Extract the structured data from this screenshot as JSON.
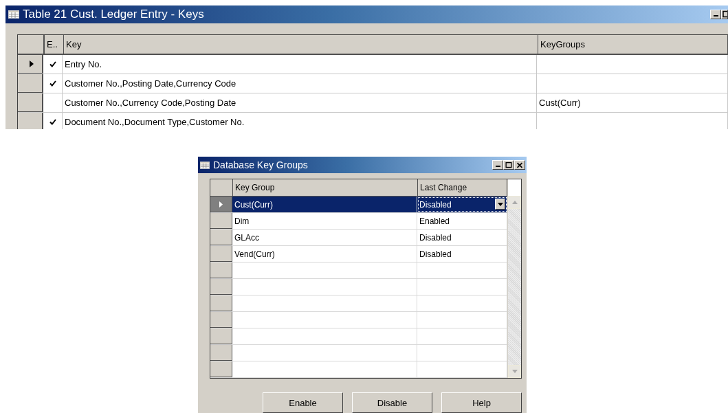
{
  "main_window": {
    "title": "Table 21 Cust. Ledger Entry - Keys",
    "table": {
      "columns": [
        "E..",
        "Key",
        "KeyGroups"
      ],
      "rows": [
        {
          "selected": true,
          "enabled": true,
          "key": "Entry No.",
          "key_groups": ""
        },
        {
          "selected": false,
          "enabled": true,
          "key": "Customer No.,Posting Date,Currency Code",
          "key_groups": ""
        },
        {
          "selected": false,
          "enabled": false,
          "key": "Customer No.,Currency Code,Posting Date",
          "key_groups": "Cust(Curr)"
        },
        {
          "selected": false,
          "enabled": true,
          "key": "Document No.,Document Type,Customer No.",
          "key_groups": ""
        }
      ]
    }
  },
  "dialog": {
    "title": "Database Key Groups",
    "table": {
      "columns": [
        "Key Group",
        "Last Change"
      ],
      "rows": [
        {
          "selected": true,
          "key_group": "Cust(Curr)",
          "last_change": "Disabled"
        },
        {
          "selected": false,
          "key_group": "Dim",
          "last_change": "Enabled"
        },
        {
          "selected": false,
          "key_group": "GLAcc",
          "last_change": "Disabled"
        },
        {
          "selected": false,
          "key_group": "Vend(Curr)",
          "last_change": "Disabled"
        }
      ]
    },
    "buttons": [
      "Enable",
      "Disable",
      "Help"
    ]
  }
}
